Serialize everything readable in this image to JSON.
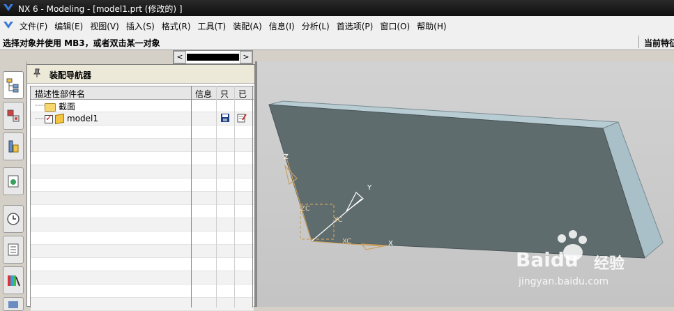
{
  "window": {
    "title": "NX 6 - Modeling - [model1.prt  (修改的) ]"
  },
  "menubar": {
    "items": [
      "文件(F)",
      "编辑(E)",
      "视图(V)",
      "插入(S)",
      "格式(R)",
      "工具(T)",
      "装配(A)",
      "信息(I)",
      "分析(L)",
      "首选项(P)",
      "窗口(O)",
      "帮助(H)"
    ]
  },
  "statusbar": {
    "prompt": "选择对象并使用 MB3，或者双击某一对象",
    "right_text": "当前特征"
  },
  "slider": {
    "left_arrow": "<",
    "right_arrow": ">"
  },
  "resource_bar": {
    "tabs": [
      "assembly-navigator-icon",
      "constraint-navigator-icon",
      "part-navigator-icon",
      "web-browser-icon",
      "history-icon",
      "system-materials-icon",
      "roles-icon"
    ]
  },
  "navigator": {
    "title": "装配导航器",
    "columns": [
      "描述性部件名",
      "信息",
      "只",
      "已"
    ],
    "rows": [
      {
        "name": "截面",
        "type": "folder"
      },
      {
        "name": "model1",
        "type": "part",
        "checked": true,
        "read_only_icon": "save-icon",
        "modified_icon": "edit-icon"
      }
    ]
  },
  "viewport": {
    "axis_labels": [
      "Z",
      "Y",
      "X",
      "ZC",
      "YC",
      "XC"
    ],
    "colors": {
      "face_dark": "#5f6c6e",
      "face_top": "#b8ccd4",
      "face_side": "#a9c0c8",
      "background": "#cacaca",
      "csys": "#c8a060"
    }
  },
  "watermark": {
    "brand": "Baidu",
    "brand_cn": "经验",
    "url": "jingyan.baidu.com"
  }
}
